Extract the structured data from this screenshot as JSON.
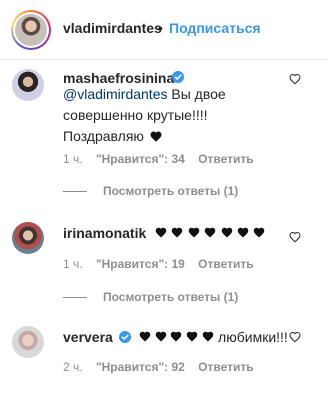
{
  "header": {
    "username": "vladimirdantes",
    "separator": "•",
    "follow_label": "Подписаться"
  },
  "comments": [
    {
      "username": "mashaefrosinina",
      "verified": true,
      "mention": "@vladimirdantes",
      "text_line1": " Вы двое",
      "text_line2": "совершенно крутые!!!!",
      "text_line3": "Поздравляю",
      "time": "1 ч.",
      "likes": "\"Нравится\": 34",
      "reply": "Ответить",
      "view_replies": "Посмотреть ответы (1)"
    },
    {
      "username": "irinamonatik",
      "verified": false,
      "time": "1 ч.",
      "likes": "\"Нравится\": 19",
      "reply": "Ответить",
      "view_replies": "Посмотреть ответы (1)"
    },
    {
      "username": "ververa",
      "verified": true,
      "text_after": " любимки!!!",
      "time": "2 ч.",
      "likes": "\"Нравится\": 92",
      "reply": "Ответить"
    }
  ],
  "icons": {
    "like": "heart-outline-icon",
    "verified": "verified-badge-icon",
    "inline_heart": "black-heart-icon"
  },
  "colors": {
    "link": "#3897f0",
    "verified": "#3897f0",
    "mention": "#003569",
    "meta": "#8e8e8e"
  }
}
